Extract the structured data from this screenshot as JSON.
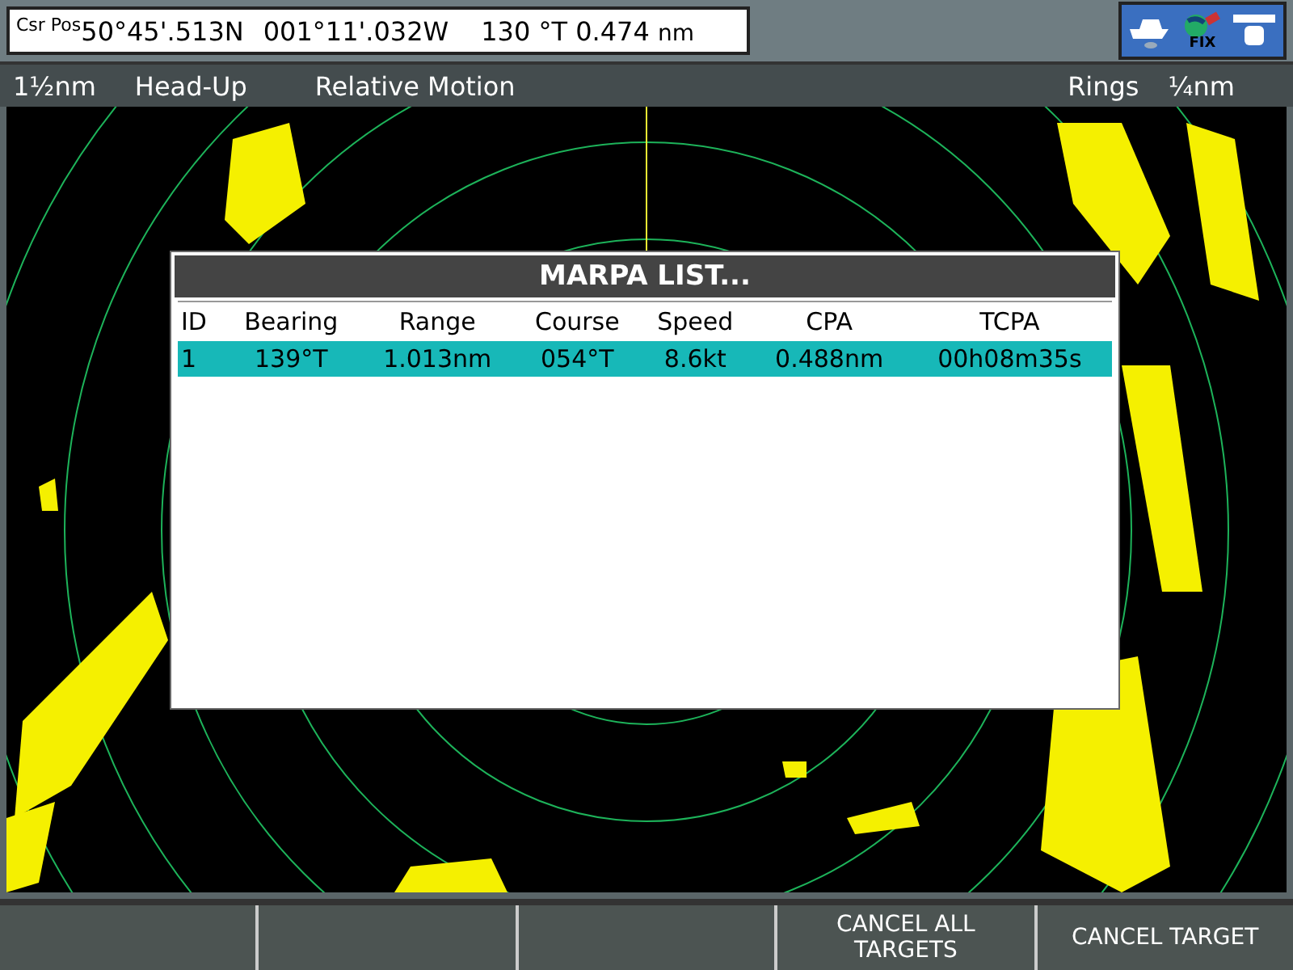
{
  "cursor_bar": {
    "label": "Csr Pos",
    "latitude": "50°45'.513N",
    "longitude": "001°11'.032W",
    "bearing": "130 °T",
    "distance": "0.474",
    "unit": "nm"
  },
  "status_icons": {
    "fix_label": "FIX"
  },
  "radar_status": {
    "range": "1½nm",
    "orientation": "Head-Up",
    "motion": "Relative Motion",
    "rings_label": "Rings",
    "rings_value": "¼nm"
  },
  "marpa_list": {
    "title": "MARPA LIST...",
    "columns": [
      "ID",
      "Bearing",
      "Range",
      "Course",
      "Speed",
      "CPA",
      "TCPA"
    ],
    "rows": [
      {
        "cells": [
          "1",
          "139°T",
          "1.013nm",
          "054°T",
          "8.6kt",
          "0.488nm",
          "00h08m35s"
        ],
        "selected": true
      }
    ]
  },
  "softkeys": [
    "CANCEL ALL TARGETS",
    "CANCEL TARGET"
  ]
}
